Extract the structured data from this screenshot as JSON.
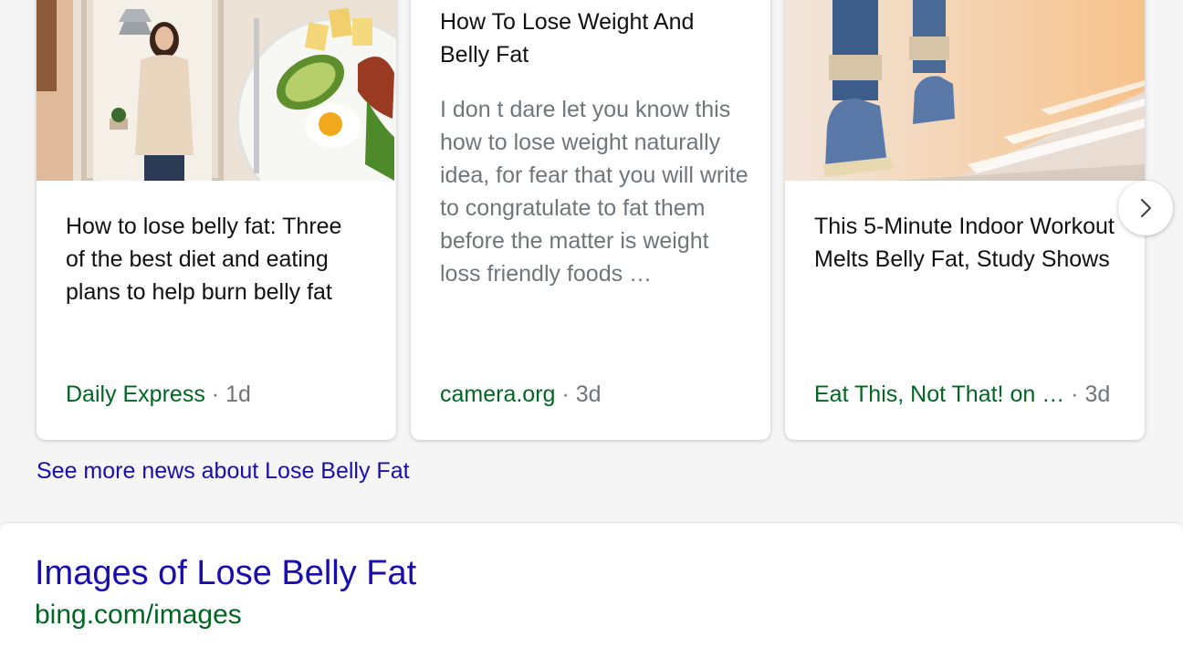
{
  "news": {
    "cards": [
      {
        "title": "How to lose belly fat: Three of the best diet and eating plans to help burn belly fat",
        "snippet": "",
        "source": "Daily Express",
        "separator": "·",
        "age": "1d",
        "image": "woman-mirror-and-breakfast-plate-photo"
      },
      {
        "title": "How To Lose Weight And Belly Fat",
        "snippet": "I don t dare let you know this how to lose weight naturally idea, for fear that you will write to congratulate to fat them before the matter is weight loss friendly foods …",
        "source": "camera.org",
        "separator": "·",
        "age": "3d",
        "image": ""
      },
      {
        "title": "This 5-Minute Indoor Workout Melts Belly Fat, Study Shows",
        "snippet": "",
        "source": "Eat This, Not That! on …",
        "separator": "·",
        "age": "3d",
        "image": "person-climbing-stairs-photo"
      }
    ],
    "next_icon": "chevron-right-icon",
    "see_more": "See more news about Lose Belly Fat"
  },
  "images_result": {
    "title": "Images of Lose Belly Fat",
    "url": "bing.com/images"
  },
  "colors": {
    "link": "#1a0dab",
    "source": "#006621",
    "muted": "#70757a",
    "text": "#111111"
  }
}
